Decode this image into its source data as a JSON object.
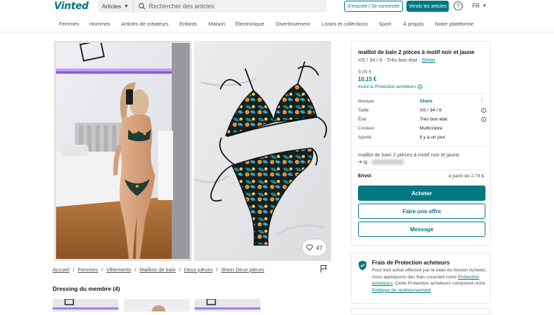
{
  "header": {
    "logo": "Vinted",
    "category_select": "Articles",
    "search_placeholder": "Rechercher des articles",
    "signup_label": "S'inscrire | Se connecter",
    "sell_label": "Vends tes articles",
    "help_symbol": "?",
    "language": "FR"
  },
  "catnav": [
    "Femmes",
    "Hommes",
    "Articles de créateurs",
    "Enfants",
    "Maison",
    "Électronique",
    "Divertissement",
    "Loisirs et collections",
    "Sport",
    "À propos",
    "Notre plateforme"
  ],
  "listing": {
    "likes": "47",
    "title": "maillot de bain 2 pièces à motif noir et jaune",
    "subtitle": "XS / 34 / 6 · Très bon état · ",
    "brand_link": "Shein",
    "price": "9,00 €",
    "price_with_protection": "10,15 €",
    "protection_included": "Inclut la Protection acheteurs",
    "details": [
      {
        "label": "Marque",
        "value": "Shein"
      },
      {
        "label": "Taille",
        "value": "XS / 34 / 6"
      },
      {
        "label": "État",
        "value": "Très bon état"
      },
      {
        "label": "Couleur",
        "value": "Multicolore"
      },
      {
        "label": "Ajouté",
        "value": "Il y a un jour"
      }
    ],
    "description_title": "maillot de bain 2 pièces à motif noir et jaune",
    "description_ig": "➜ ig :",
    "shipping_label": "Envoi",
    "shipping_value": "à partir de 2,79 €",
    "buy_label": "Acheter",
    "offer_label": "Faire une offre",
    "message_label": "Message"
  },
  "breadcrumb": [
    "Accueil",
    "Femmes",
    "Vêtements",
    "Maillots de bain",
    "Deux pièces",
    "Shein Deux pièces"
  ],
  "wardrobe_title": "Dressing du membre (4)",
  "protection": {
    "title": "Frais de Protection acheteurs",
    "text_1": "Pour tout achat effectué par le biais du bouton Acheter, nous appliquons des frais couvrant notre ",
    "link_1": "Protection acheteurs",
    "text_2": ". Cette Protection acheteurs comprend notre ",
    "link_2": "Politique de remboursement",
    "text_3": "."
  },
  "colors": {
    "brand": "#007782",
    "text": "#171717",
    "muted": "#4d4d4d"
  }
}
